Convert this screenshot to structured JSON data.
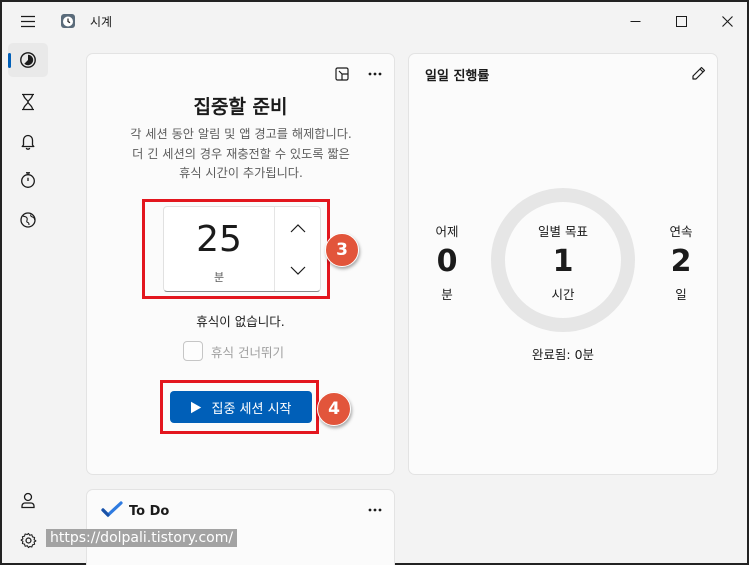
{
  "window": {
    "title": "시계",
    "buttons": {
      "minimize": "minimize-icon",
      "maximize": "maximize-icon",
      "close": "close-icon"
    }
  },
  "nav": {
    "items": [
      {
        "name": "focus-sessions",
        "icon": "focus-icon",
        "active": true
      },
      {
        "name": "timer",
        "icon": "hourglass-icon"
      },
      {
        "name": "alarm",
        "icon": "bell-icon"
      },
      {
        "name": "stopwatch",
        "icon": "stopwatch-icon"
      },
      {
        "name": "world-clock",
        "icon": "globe-icon"
      }
    ],
    "footer": [
      {
        "name": "account",
        "icon": "person-icon"
      },
      {
        "name": "settings",
        "icon": "gear-icon"
      }
    ]
  },
  "focus": {
    "title": "집중할 준비",
    "description_line1": "각 세션 동안 알림 및 앱 경고를 해제합니다.",
    "description_line2": "더 긴 세션의 경우 재충전할 수 있도록 짧은",
    "description_line3": "휴식 시간이 추가됩니다.",
    "minutes_value": "25",
    "minutes_unit": "분",
    "break_text": "휴식이 없습니다.",
    "skip_break_label": "휴식 건너뛰기",
    "skip_break_checked": false,
    "start_label": "집중 세션 시작"
  },
  "progress": {
    "title": "일일 진행률",
    "yesterday": {
      "label": "어제",
      "value": "0",
      "unit": "분"
    },
    "daily_goal": {
      "label": "일별 목표",
      "value": "1",
      "unit": "시간"
    },
    "streak": {
      "label": "연속",
      "value": "2",
      "unit": "일"
    },
    "completed": "완료됨: 0분"
  },
  "todo": {
    "title": "To Do"
  },
  "annotations": {
    "step3": "3",
    "step4": "4"
  },
  "watermark": "https://dolpali.tistory.com/",
  "colors": {
    "accent": "#005fb8",
    "highlight": "#e3161e",
    "badge": "#e2553b",
    "background": "#f3f3f3"
  }
}
